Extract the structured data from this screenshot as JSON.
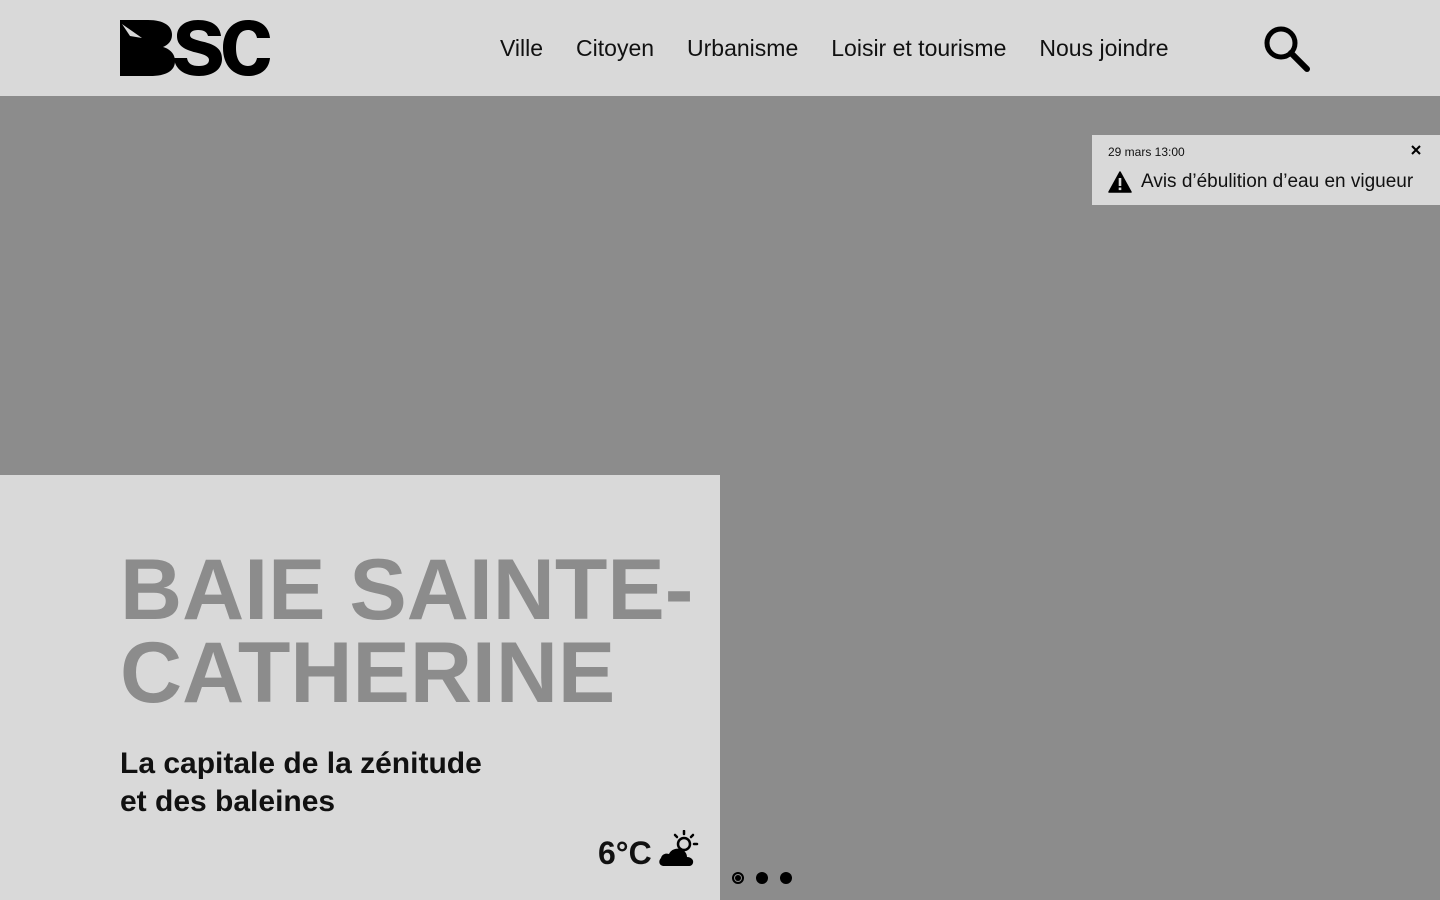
{
  "header": {
    "logo_text": "BSC",
    "logo_icon": "bsc-logo",
    "nav": [
      {
        "label": "Ville"
      },
      {
        "label": "Citoyen"
      },
      {
        "label": "Urbanisme"
      },
      {
        "label": "Loisir et tourisme"
      },
      {
        "label": "Nous joindre"
      }
    ],
    "search_icon": "search-icon"
  },
  "alert": {
    "timestamp": "29 mars 13:00",
    "message": "Avis d’ébulition d’eau en vigueur",
    "icon": "warning-icon",
    "close_icon": "close-icon"
  },
  "hero": {
    "title_line1": "BAIE SAINTE-",
    "title_line2": "CATHERINE",
    "subtitle_line1": "La capitale de la zénitude",
    "subtitle_line2": "et des baleines",
    "temperature": "6°C",
    "weather_icon": "partly-cloudy-icon",
    "slides": [
      {
        "active": true
      },
      {
        "active": false
      },
      {
        "active": false
      }
    ]
  },
  "colors": {
    "header_bg": "#d9d9d9",
    "hero_bg": "#8c8c8c",
    "title_color": "#8c8c8c",
    "text": "#111111"
  }
}
